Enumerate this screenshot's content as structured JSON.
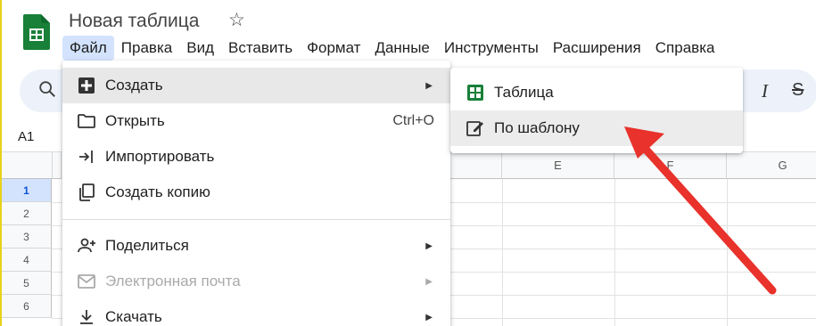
{
  "document": {
    "title": "Новая таблица"
  },
  "menubar": {
    "items": [
      "Файл",
      "Правка",
      "Вид",
      "Вставить",
      "Формат",
      "Данные",
      "Инструменты",
      "Расширения",
      "Справка"
    ]
  },
  "namebox": {
    "value": "A1"
  },
  "columns": [
    "E",
    "F",
    "G"
  ],
  "rows": [
    "1",
    "2",
    "3",
    "4",
    "5",
    "6"
  ],
  "file_menu": {
    "items": [
      {
        "label": "Создать",
        "icon": "plus-square-icon",
        "has_submenu": true,
        "highlighted": true
      },
      {
        "label": "Открыть",
        "icon": "folder-icon",
        "shortcut": "Ctrl+O"
      },
      {
        "label": "Импортировать",
        "icon": "import-icon"
      },
      {
        "label": "Создать копию",
        "icon": "copy-icon"
      },
      {
        "label": "Поделиться",
        "icon": "share-person-icon",
        "has_submenu": true
      },
      {
        "label": "Электронная почта",
        "icon": "mail-icon",
        "has_submenu": true,
        "disabled": true
      },
      {
        "label": "Скачать",
        "icon": "download-icon",
        "has_submenu": true
      }
    ]
  },
  "create_submenu": {
    "items": [
      {
        "label": "Таблица",
        "icon": "sheets-icon"
      },
      {
        "label": "По шаблону",
        "icon": "template-icon",
        "highlighted": true
      }
    ]
  },
  "colors": {
    "accent": "#0b57d0",
    "sheets_green": "#188038",
    "menu_active": "#d3e3fd",
    "annotation_arrow": "#e8322b"
  }
}
